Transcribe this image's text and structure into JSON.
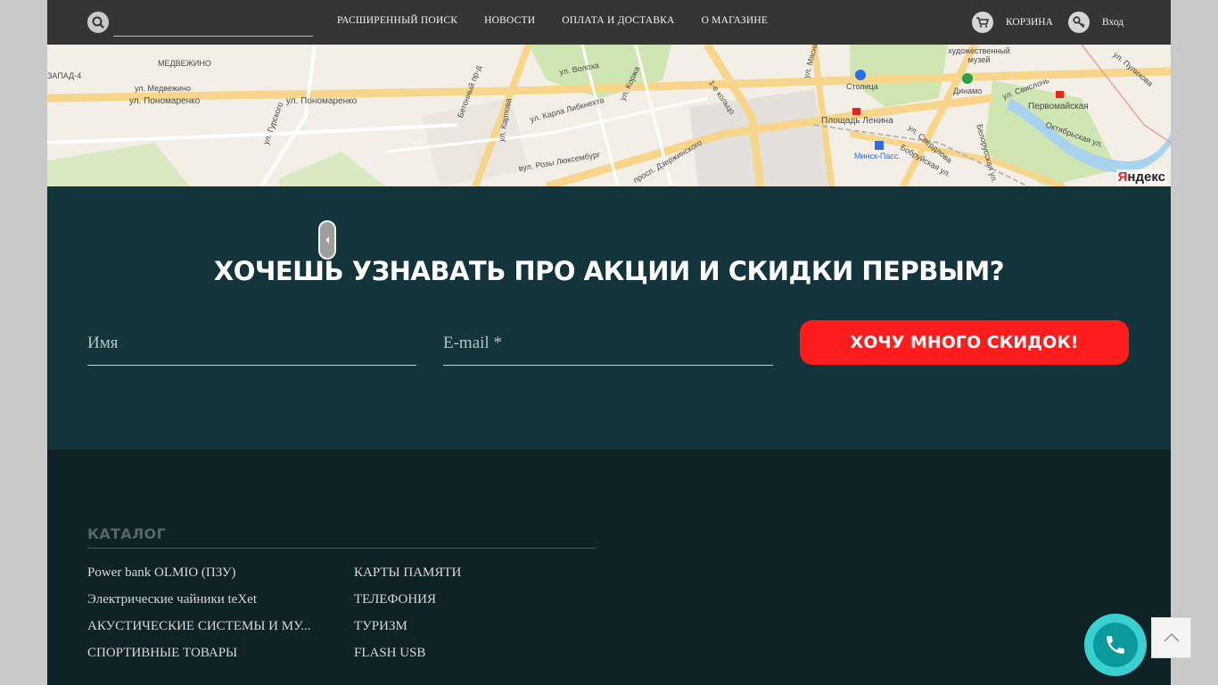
{
  "header": {
    "search_placeholder": "",
    "nav": [
      "РАСШИРЕННЫЙ ПОИСК",
      "НОВОСТИ",
      "ОПЛАТА И ДОСТАВКА",
      "О МАГАЗИНЕ"
    ],
    "cart_label": "КОРЗИНА",
    "login_label": "Вход",
    "icons": {
      "search": "search-icon",
      "cart": "cart-icon",
      "login": "key-icon"
    }
  },
  "map": {
    "labels": [
      "МЕДВЕЖИНО",
      "ЗАПАД-4",
      "ул. Медвежино",
      "ул. Пономаренко",
      "ул. Пономаренко",
      "ул. Гурского",
      "Бетонный пр-д",
      "ул. Карпова",
      "ул. Волоха",
      "ул. Карла Либкнехта",
      "ул. Коржа",
      "вул. Розы Люксембург",
      "просп. Дзержинского",
      "1-е кольцо",
      "ул. Мясникова",
      "Столица",
      "Площадь Ленина",
      "Минск-Пасс.",
      "ул. Свердлова",
      "Бобруйская ул.",
      "художественный музей",
      "Динамо",
      "Первомайская",
      "ул. Свислочь",
      "Белорусская ул.",
      "Октябрьская ул.",
      "ул. Пулихова"
    ],
    "logo_a": "Я",
    "logo_b": "ндекс"
  },
  "subscribe": {
    "title": "ХОЧЕШЬ УЗНАВАТЬ ПРО АКЦИИ И СКИДКИ ПЕРВЫМ?",
    "name_placeholder": "Имя",
    "email_placeholder": "E-mail *",
    "button_label": "ХОЧУ МНОГО СКИДОК!"
  },
  "footer": {
    "catalog_title": "КАТАЛОГ",
    "col1": [
      "Power bank OLMIO (ПЗУ)",
      "Электрические чайники teXet",
      "АКУСТИЧЕСКИЕ СИСТЕМЫ И МУ...",
      "СПОРТИВНЫЕ ТОВАРЫ"
    ],
    "col2": [
      "КАРТЫ ПАМЯТИ",
      "ТЕЛЕФОНИЯ",
      "ТУРИЗМ",
      "FLASH USB"
    ]
  },
  "widgets": {
    "call_icon": "phone-icon",
    "up_icon": "chevron-up-icon"
  },
  "colors": {
    "topbar": "#353535",
    "subscribe_bg": "#12343a",
    "footer_bg": "#0f2225",
    "cta": "#ff1c1c",
    "call": "#39d0d0"
  }
}
